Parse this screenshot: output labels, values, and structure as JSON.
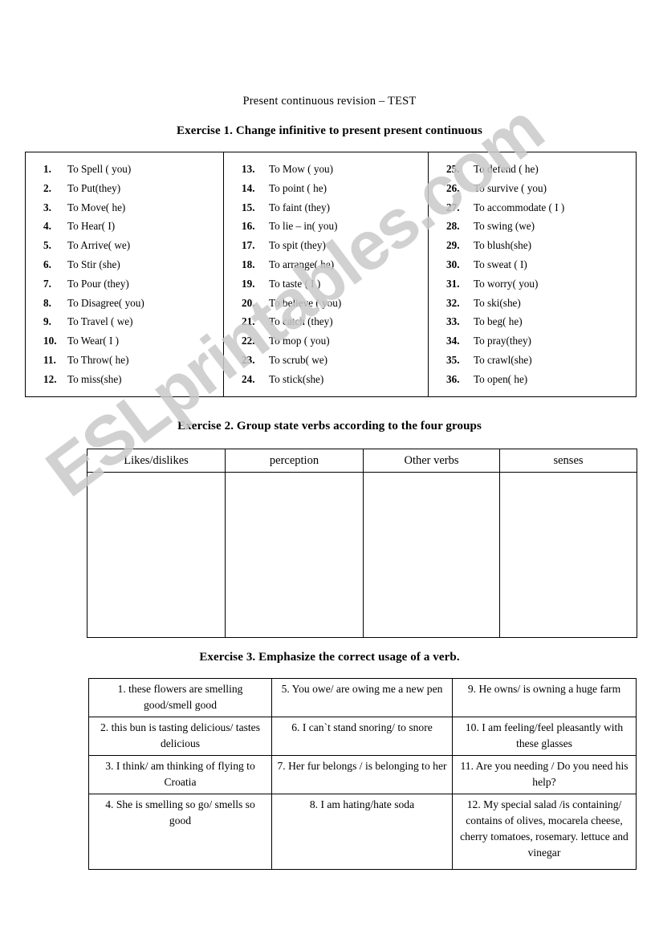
{
  "document": {
    "title": "Present continuous revision – TEST",
    "watermark": "ESLprintables.com"
  },
  "exercise1": {
    "heading": "Exercise 1. Change infinitive to present present continuous",
    "columns": [
      [
        {
          "num": "1.",
          "text": "To Spell ( you)"
        },
        {
          "num": "2.",
          "text": "To Put(they)"
        },
        {
          "num": "3.",
          "text": "To Move( he)"
        },
        {
          "num": "4.",
          "text": "To Hear( I)"
        },
        {
          "num": "5.",
          "text": "To Arrive( we)"
        },
        {
          "num": "6.",
          "text": "To Stir (she)"
        },
        {
          "num": "7.",
          "text": "To Pour (they)"
        },
        {
          "num": "8.",
          "text": "To Disagree( you)"
        },
        {
          "num": "9.",
          "text": "To Travel ( we)"
        },
        {
          "num": "10.",
          "text": "To Wear( I )"
        },
        {
          "num": "11.",
          "text": "To Throw( he)"
        },
        {
          "num": "12.",
          "text": "To miss(she)"
        }
      ],
      [
        {
          "num": "13.",
          "text": "To Mow ( you)"
        },
        {
          "num": "14.",
          "text": "To point ( he)"
        },
        {
          "num": "15.",
          "text": "To faint (they)"
        },
        {
          "num": "16.",
          "text": "To lie – in( you)"
        },
        {
          "num": "17.",
          "text": "To spit (they)"
        },
        {
          "num": "18.",
          "text": "To arrange( he)"
        },
        {
          "num": "19.",
          "text": "To taste ( I )"
        },
        {
          "num": "20.",
          "text": "To believe ( you)"
        },
        {
          "num": "21.",
          "text": "To catch (they)"
        },
        {
          "num": "22.",
          "text": "To mop ( you)"
        },
        {
          "num": "23.",
          "text": "To scrub( we)"
        },
        {
          "num": "24.",
          "text": "To stick(she)"
        }
      ],
      [
        {
          "num": "25.",
          "text": "To defend ( he)"
        },
        {
          "num": "26.",
          "text": "To survive ( you)"
        },
        {
          "num": "27.",
          "text": "To accommodate ( I )"
        },
        {
          "num": "28.",
          "text": "To swing (we)"
        },
        {
          "num": "29.",
          "text": "To blush(she)"
        },
        {
          "num": "30.",
          "text": "To sweat ( I)"
        },
        {
          "num": "31.",
          "text": "To worry( you)"
        },
        {
          "num": "32.",
          "text": "To ski(she)"
        },
        {
          "num": "33.",
          "text": "To beg( he)"
        },
        {
          "num": "34.",
          "text": "To pray(they)"
        },
        {
          "num": "35.",
          "text": "To crawl(she)"
        },
        {
          "num": "36.",
          "text": "To open( he)"
        }
      ]
    ]
  },
  "exercise2": {
    "heading": "Exercise 2. Group state verbs according to the four groups",
    "headers": [
      "Likes/dislikes",
      "perception",
      "Other verbs",
      "senses"
    ],
    "cells": [
      "",
      "",
      "",
      ""
    ]
  },
  "exercise3": {
    "heading": "Exercise 3. Emphasize the correct usage of a verb.",
    "rows": [
      [
        "1. these flowers are smelling good/smell good",
        "5.  You owe/ are owing me a new pen",
        "9. He owns/ is owning a huge farm"
      ],
      [
        "2. this bun is tasting delicious/ tastes delicious",
        "6. I can`t stand snoring/ to snore",
        "10. I  am feeling/feel pleasantly with these glasses"
      ],
      [
        "3. I think/ am thinking of flying to Croatia",
        "7. Her fur belongs / is belonging to her",
        "11. Are you needing / Do you need his help?"
      ],
      [
        "4. She is smelling so go/ smells so good",
        "8. I am hating/hate soda",
        "12. My special salad /is containing/ contains of olives, mocarela cheese, cherry tomatoes, rosemary. lettuce and vinegar"
      ]
    ]
  }
}
